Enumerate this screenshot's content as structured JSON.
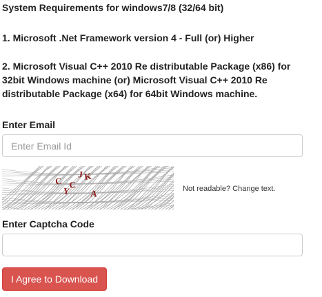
{
  "requirements": {
    "heading": "System Requirements for windows7/8 (32/64 bit)",
    "item1": "1. Microsoft .Net Framework version 4 - Full (or) Higher",
    "item2": "2. Microsoft Visual C++ 2010 Re distributable Package (x86) for 32bit Windows machine (or) Microsoft Visual C++ 2010 Re distributable Package (x64) for 64bit Windows machine."
  },
  "email": {
    "label": "Enter Email",
    "placeholder": "Enter Email Id",
    "value": ""
  },
  "captcha": {
    "letters": [
      "C",
      "Y",
      "C",
      "J",
      "K",
      "A"
    ],
    "letter_color": "#8b1a1a",
    "change_text": "Not readable? Change text."
  },
  "captcha_code": {
    "label": "Enter Captcha Code",
    "value": ""
  },
  "submit": {
    "label": "I Agree to Download",
    "color": "#d9534f"
  }
}
